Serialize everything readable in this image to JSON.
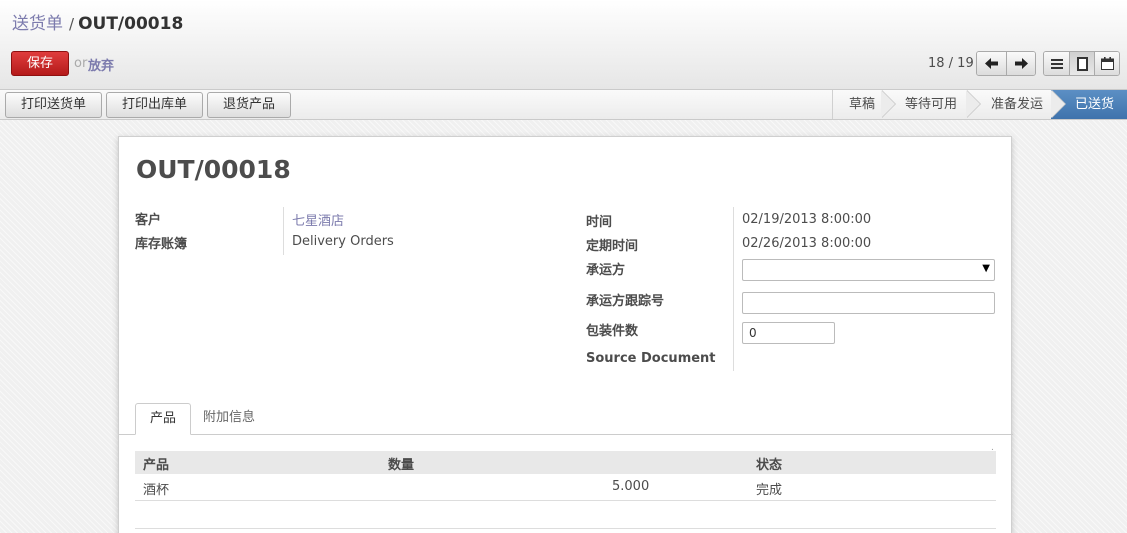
{
  "breadcrumb": {
    "parent": "送货单",
    "separator": "/",
    "current": "OUT/00018"
  },
  "toolbar": {
    "save_label": "保存",
    "or_text": "or",
    "discard_label": "放弃"
  },
  "pager": {
    "value": "18 / 19"
  },
  "actions": {
    "print_delivery": "打印送货单",
    "print_picking": "打印出库单",
    "return_products": "退货产品"
  },
  "stages": {
    "draft": "草稿",
    "waiting": "等待可用",
    "ready": "准备发运",
    "done": "已送货"
  },
  "form": {
    "title": "OUT/00018",
    "customer_label": "客户",
    "customer_value": "七星酒店",
    "journal_label": "库存账簿",
    "journal_value": "Delivery Orders",
    "date_label": "时间",
    "date_value": "02/19/2013 8:00:00",
    "scheduled_label": "定期时间",
    "scheduled_value": "02/26/2013 8:00:00",
    "carrier_label": "承运方",
    "carrier_value": "",
    "tracking_label": "承运方跟踪号",
    "tracking_value": "",
    "packages_label": "包装件数",
    "packages_value": "0",
    "source_label": "Source Document"
  },
  "tabs": {
    "products": "产品",
    "additional": "附加信息"
  },
  "table": {
    "headers": {
      "product": "产品",
      "quantity": "数量",
      "status": "状态"
    },
    "rows": [
      {
        "product": "酒杯",
        "quantity": "5.000",
        "status": "完成"
      }
    ]
  },
  "colors": {
    "save": "#c9302c",
    "link": "#7c7bad",
    "current_stage": "#4a7eb8"
  },
  "icons": {
    "prev": "arrow-left-icon",
    "next": "arrow-right-icon",
    "list": "list-view-icon",
    "form": "form-view-icon",
    "calendar": "calendar-view-icon"
  }
}
